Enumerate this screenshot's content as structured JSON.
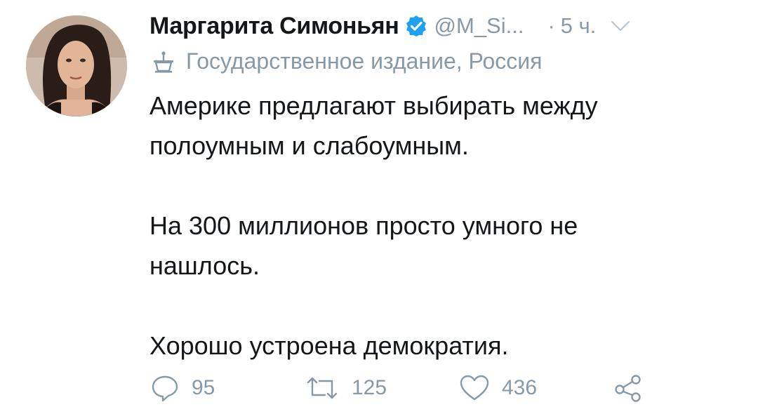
{
  "author": {
    "display_name": "Маргарита Симоньян",
    "handle": "@M_Si...",
    "time_dot": "·",
    "time": "5 ч.",
    "label": "Государственное издание, Россия"
  },
  "tweet": {
    "lines": [
      "Америке предлагают выбирать между",
      "полоумным и слабоумным.",
      "",
      "На 300 миллионов просто умного не",
      "нашлось.",
      "",
      "Хорошо устроена демократия."
    ]
  },
  "actions": {
    "reply_count": "95",
    "retweet_count": "125",
    "like_count": "436"
  },
  "colors": {
    "text": "#14171a",
    "muted": "#8899a6",
    "verified": "#1da1f2"
  },
  "icons": {
    "verified": "verified-badge-icon",
    "chevron": "chevron-down-icon",
    "label": "podium-icon",
    "reply": "reply-icon",
    "retweet": "retweet-icon",
    "like": "heart-icon",
    "share": "share-icon"
  }
}
